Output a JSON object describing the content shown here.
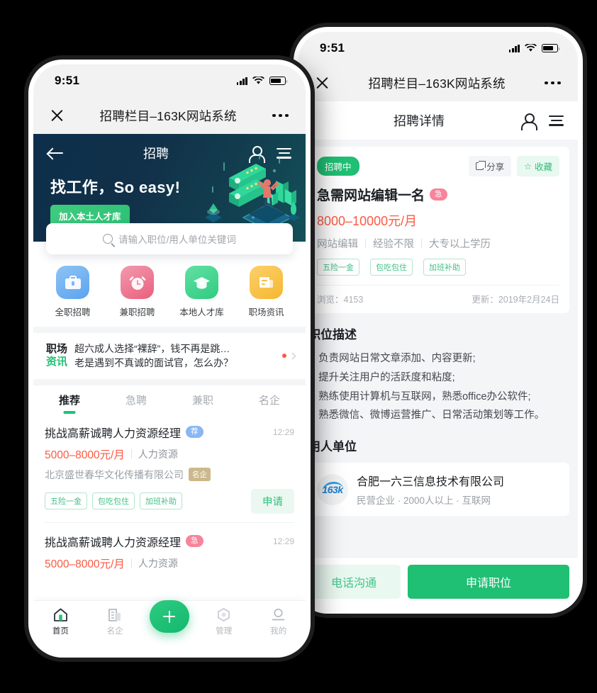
{
  "statusbar": {
    "time": "9:51"
  },
  "wechat_nav": {
    "title": "招聘栏目–163K网站系统"
  },
  "left_phone": {
    "hero": {
      "back_icon": "back-arrow-icon",
      "title": "招聘",
      "person_icon": "person-icon",
      "menu_icon": "hamburger-menu-icon",
      "headline": "找工作，So easy!",
      "cta": "加入本土人才库"
    },
    "search": {
      "placeholder": "请输入职位/用人单位关键词",
      "icon": "search-icon"
    },
    "quick_entries": [
      {
        "label": "全职招聘",
        "icon": "briefcase-icon",
        "color": "#5ba3ef"
      },
      {
        "label": "兼职招聘",
        "icon": "alarm-clock-icon",
        "color": "#ea5f7e"
      },
      {
        "label": "本地人才库",
        "icon": "graduation-cap-icon",
        "color": "#2ecc80"
      },
      {
        "label": "职场资讯",
        "icon": "news-document-icon",
        "color": "#f5b731"
      }
    ],
    "news": {
      "badge_line1": "职场",
      "badge_line2": "资讯",
      "items": [
        "超六成人选择“裸辞”，钱不再是跳…",
        "老是遇到不真诚的面试官，怎么办？"
      ]
    },
    "tabs": [
      {
        "label": "推荐",
        "active": true
      },
      {
        "label": "急聘",
        "active": false
      },
      {
        "label": "兼职",
        "active": false
      },
      {
        "label": "名企",
        "active": false
      }
    ],
    "jobs": [
      {
        "title": "挑战高薪诚聘人力资源经理",
        "badge": "荐",
        "badge_type": "rec",
        "time": "12:29",
        "salary": "5000–8000元/月",
        "category": "人力资源",
        "company": "北京盛世春华文化传播有限公司",
        "company_tag": "名企",
        "tags": [
          "五险一金",
          "包吃包住",
          "加班补助"
        ],
        "apply_label": "申请"
      },
      {
        "title": "挑战高薪诚聘人力资源经理",
        "badge": "急",
        "badge_type": "urg",
        "time": "12:29",
        "salary": "5000–8000元/月",
        "category": "人力资源"
      }
    ],
    "tabbar": [
      {
        "label": "首页",
        "icon": "home-icon",
        "active": true
      },
      {
        "label": "名企",
        "icon": "building-icon",
        "active": false
      },
      {
        "label": "",
        "icon": "plus-fab-icon",
        "active": false
      },
      {
        "label": "管理",
        "icon": "hexagon-manage-icon",
        "active": false
      },
      {
        "label": "我的",
        "icon": "user-profile-icon",
        "active": false
      }
    ]
  },
  "right_phone": {
    "header": {
      "title": "招聘详情",
      "person_icon": "person-icon",
      "menu_icon": "hamburger-menu-icon"
    },
    "detail": {
      "status": "招聘中",
      "share_label": "分享",
      "share_icon": "share-icon",
      "fav_label": "收藏",
      "fav_icon": "star-icon",
      "title": "急需网站编辑一名",
      "badge": "急",
      "salary": "8000–10000元/月",
      "meta": [
        "网站编辑",
        "经验不限",
        "大专以上学历"
      ],
      "tags": [
        "五险一金",
        "包吃包住",
        "加班补助"
      ],
      "views_label": "浏览：4153",
      "updated_label": "更新：2019年2月24日"
    },
    "description": {
      "heading": "职位描述",
      "items": [
        "1. 负责网站日常文章添加、内容更新;",
        "2. 提升关注用户的活跃度和粘度;",
        "3. 熟练使用计算机与互联网，熟悉office办公软件;",
        "4. 熟悉微信、微博运营推广、日常活动策划等工作。"
      ]
    },
    "employer": {
      "heading": "用人单位",
      "logo_text": "163k",
      "name": "合肥一六三信息技术有限公司",
      "sub": "民营企业 · 2000人以上 · 互联网"
    },
    "actions": {
      "call": "电话沟通",
      "apply": "申请职位"
    }
  },
  "colors": {
    "brand_green": "#1fbf74",
    "salary_red": "#fb5a43",
    "hero_dark": "#0d2f4b"
  }
}
